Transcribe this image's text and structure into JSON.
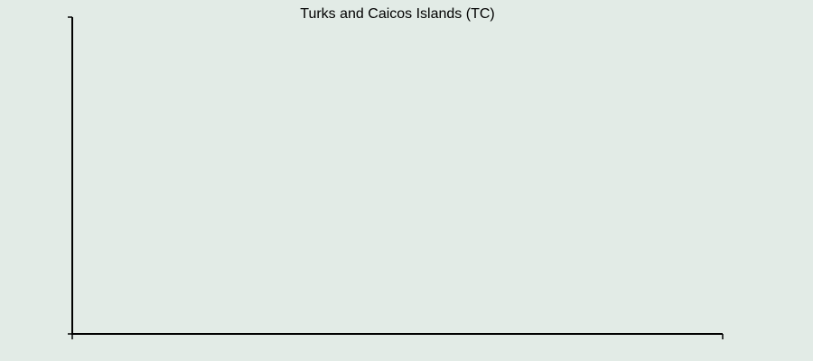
{
  "colors": {
    "background": "#e2ebe6",
    "axis": "#000000",
    "text": "#000000"
  },
  "chart_data": {
    "type": "line",
    "title": "Turks and Caicos Islands (TC)",
    "xlabel": "",
    "ylabel": "",
    "series": [],
    "grid": false,
    "legend": "none"
  }
}
